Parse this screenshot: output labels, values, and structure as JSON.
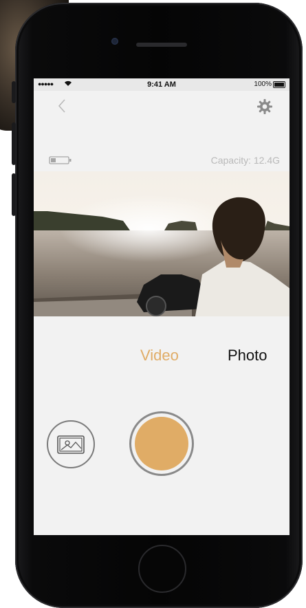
{
  "status_bar": {
    "signal": "●●●●●",
    "time": "9:41 AM",
    "battery_pct": "100%"
  },
  "nav": {
    "back_icon": "chevron-left-icon",
    "settings_icon": "gear-icon"
  },
  "info": {
    "battery_icon": "battery-low-icon",
    "capacity": "Capacity: 12.4G"
  },
  "modes": {
    "video_label": "Video",
    "photo_label": "Photo",
    "selected": "Video"
  },
  "colors": {
    "accent": "#e0ac66",
    "text_dark": "#111111",
    "muted": "#b9b9b9"
  }
}
